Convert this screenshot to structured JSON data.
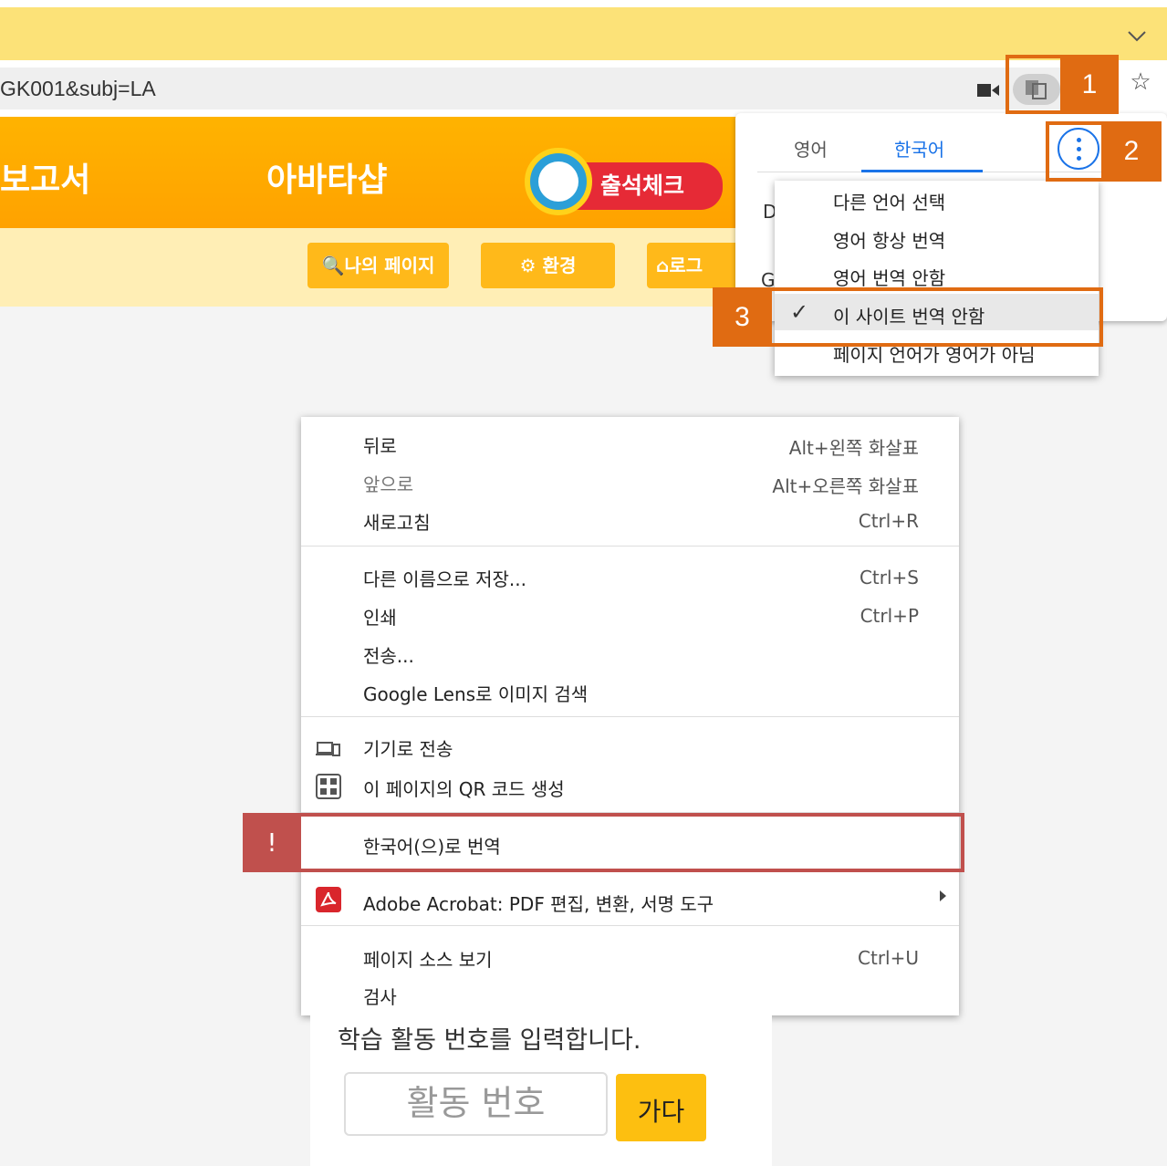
{
  "browser": {
    "url_text": "GK001&subj=LA",
    "chevron": "chevron-down-icon",
    "star": "star-icon"
  },
  "page": {
    "banner_left": "보고서",
    "banner_shop": "아바타샵",
    "attendance": "출석체크",
    "nav": {
      "my_page": "나의 페이지",
      "settings": "환경",
      "logout": "로그"
    },
    "card_title": "학습 활동 번호를 입력합니다.",
    "activity_placeholder": "활동 번호",
    "go": "가다"
  },
  "translate_popup": {
    "tab_source": "영어",
    "tab_target": "한국어",
    "options": [
      "다른 언어 선택",
      "영어 항상 번역",
      "영어 번역 안함",
      "이 사이트 번역 안함",
      "페이지 언어가 영어가 아님"
    ],
    "checked_option": "이 사이트 번역 안함",
    "ghost_left_1": "D",
    "ghost_left_2": "G"
  },
  "context_menu": {
    "items": [
      {
        "label": "뒤로",
        "shortcut": "Alt+왼쪽 화살표"
      },
      {
        "label": "앞으로",
        "shortcut": "Alt+오른쪽 화살표"
      },
      {
        "label": "새로고침",
        "shortcut": "Ctrl+R"
      },
      {
        "label": "다른 이름으로 저장...",
        "shortcut": "Ctrl+S"
      },
      {
        "label": "인쇄",
        "shortcut": "Ctrl+P"
      },
      {
        "label": "전송..."
      },
      {
        "label": "Google Lens로 이미지 검색"
      },
      {
        "label": "기기로 전송",
        "icon": "devices-icon"
      },
      {
        "label": "이 페이지의 QR 코드 생성",
        "icon": "qr-code-icon"
      },
      {
        "label": "한국어(으)로 번역"
      },
      {
        "label": "Adobe Acrobat: PDF 편집, 변환, 서명 도구",
        "icon": "adobe-acrobat-icon"
      },
      {
        "label": "페이지 소스 보기",
        "shortcut": "Ctrl+U"
      },
      {
        "label": "검사"
      }
    ]
  },
  "annotations": {
    "step1": "1",
    "step2": "2",
    "step3": "3",
    "alert": "!",
    "orange": "#e06b12",
    "red": "#c0504d"
  }
}
